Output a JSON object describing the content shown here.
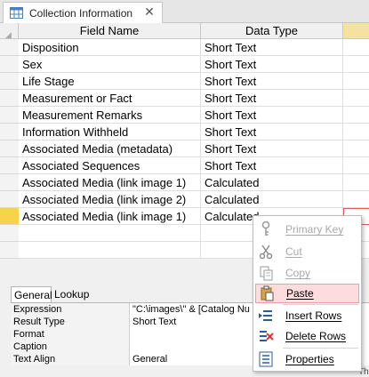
{
  "tab": {
    "label": "Collection Information",
    "close_glyph": "✕"
  },
  "grid": {
    "headers": {
      "field": "Field Name",
      "type": "Data Type"
    },
    "rows": [
      {
        "field": "Disposition",
        "type": "Short Text"
      },
      {
        "field": "Sex",
        "type": "Short Text"
      },
      {
        "field": "Life Stage",
        "type": "Short Text"
      },
      {
        "field": "Measurement or Fact",
        "type": "Short Text"
      },
      {
        "field": "Measurement Remarks",
        "type": "Short Text"
      },
      {
        "field": "Information Withheld",
        "type": "Short Text"
      },
      {
        "field": "Associated Media (metadata)",
        "type": "Short Text"
      },
      {
        "field": "Associated Sequences",
        "type": "Short Text"
      },
      {
        "field": "Associated Media (link image 1)",
        "type": "Calculated"
      },
      {
        "field": "Associated Media (link image 2)",
        "type": "Calculated"
      },
      {
        "field": "Associated Media (link image 1)",
        "type": "Calculated"
      }
    ]
  },
  "properties": {
    "tabs": {
      "general": "General",
      "lookup": "Lookup"
    },
    "rows": [
      {
        "name": "Expression",
        "value": "\"C:\\images\\\" & [Catalog Nu"
      },
      {
        "name": "Result Type",
        "value": "Short Text"
      },
      {
        "name": "Format",
        "value": ""
      },
      {
        "name": "Caption",
        "value": ""
      },
      {
        "name": "Text Align",
        "value": "General"
      }
    ]
  },
  "trailing_text": "Th",
  "context_menu": {
    "items": [
      {
        "label": "Primary Key",
        "icon": "key-icon",
        "disabled": true
      },
      {
        "label": "Cut",
        "icon": "scissors-icon",
        "disabled": true
      },
      {
        "label": "Copy",
        "icon": "copy-icon",
        "disabled": true
      },
      {
        "label": "Paste",
        "icon": "paste-icon",
        "disabled": false,
        "hover": true
      },
      {
        "label": "Insert Rows",
        "icon": "insert-rows-icon",
        "disabled": false
      },
      {
        "label": "Delete Rows",
        "icon": "delete-rows-icon",
        "disabled": false
      },
      {
        "label": "Properties",
        "icon": "properties-icon",
        "disabled": false
      }
    ]
  },
  "colors": {
    "current_row": "#f6d34a",
    "menu_hover": "#fcdcdc",
    "accent_red": "#e05a5a"
  }
}
